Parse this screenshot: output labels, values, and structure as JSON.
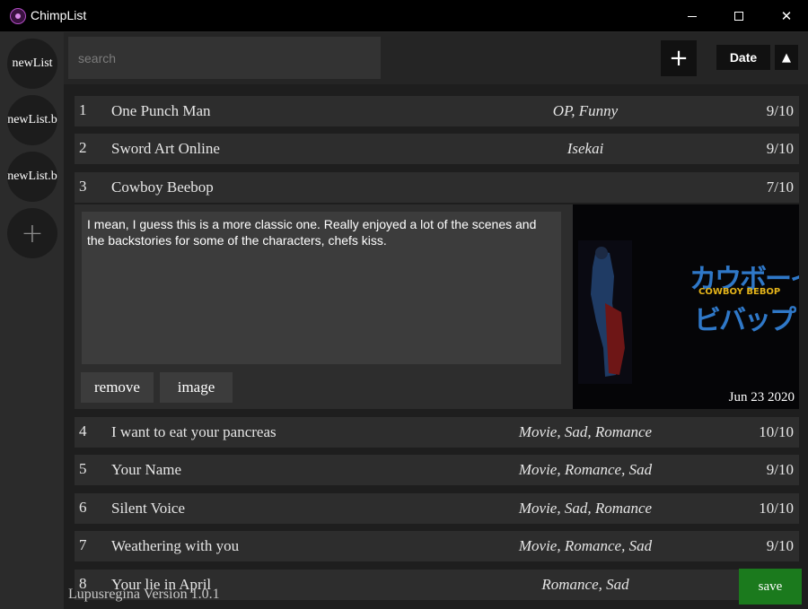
{
  "app": {
    "title": "ChimpList"
  },
  "sidebar": {
    "lists": [
      {
        "label": "newList"
      },
      {
        "label": "newList.b"
      },
      {
        "label": "newList.b"
      }
    ],
    "add_icon": "plus-icon"
  },
  "toolbar": {
    "search_placeholder": "search",
    "add_label": "+",
    "sort_label": "Date",
    "sort_direction": "▲"
  },
  "entries": [
    {
      "num": "1",
      "title": "One Punch Man",
      "tags": "OP, Funny",
      "score": "9/10"
    },
    {
      "num": "2",
      "title": "Sword Art Online",
      "tags": "Isekai",
      "score": "9/10"
    },
    {
      "num": "3",
      "title": "Cowboy Beebop",
      "tags": "",
      "score": "7/10"
    },
    {
      "num": "4",
      "title": "I want to eat your pancreas",
      "tags": "Movie, Sad, Romance",
      "score": "10/10"
    },
    {
      "num": "5",
      "title": "Your Name",
      "tags": "Movie, Romance, Sad",
      "score": "9/10"
    },
    {
      "num": "6",
      "title": "Silent Voice",
      "tags": "Movie, Sad, Romance",
      "score": "10/10"
    },
    {
      "num": "7",
      "title": "Weathering with you",
      "tags": "Movie, Romance, Sad",
      "score": "9/10"
    },
    {
      "num": "8",
      "title": "Your lie in April",
      "tags": "Romance, Sad",
      "score": ""
    }
  ],
  "expanded": {
    "notes": "I mean, I guess this is a more classic one. Really enjoyed a lot of the scenes and the backstories for some of the characters, chefs kiss.",
    "remove_label": "remove",
    "image_label": "image",
    "image_date": "Jun 23 2020",
    "cover_logo_jp": "カウボーイ",
    "cover_logo_en": "COWBOY BEBOP",
    "cover_logo_jp2": "ビバップ"
  },
  "footer": {
    "version": "Lupusregina Version 1.0.1",
    "save_label": "save"
  },
  "colors": {
    "background": "#1e1e1e",
    "row": "#2d2d2d",
    "save": "#1b7a1d"
  }
}
